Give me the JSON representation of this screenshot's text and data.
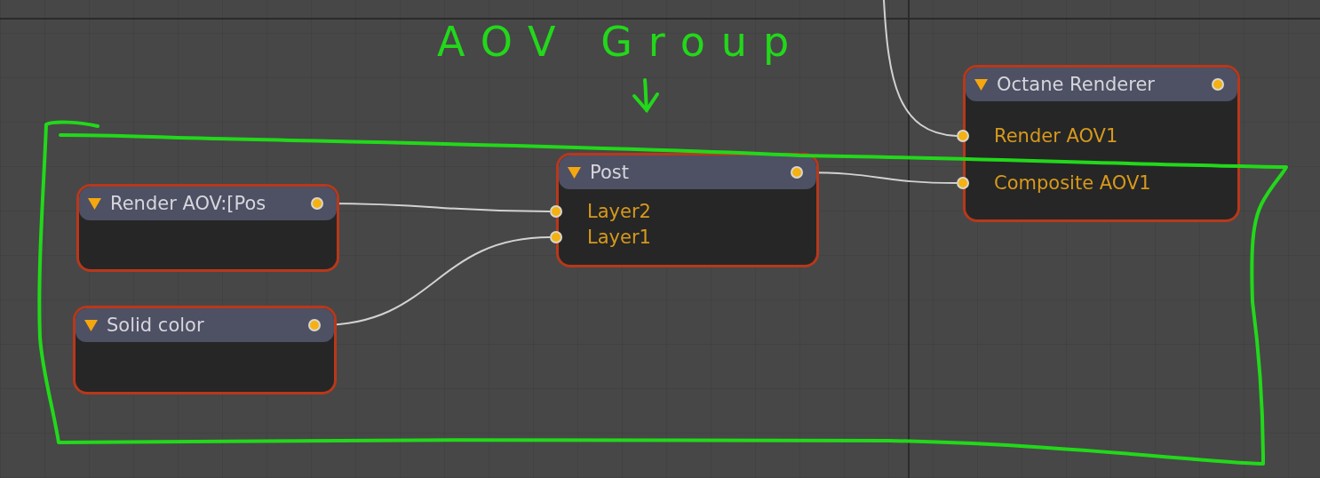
{
  "annotation": {
    "label": "AOV Group"
  },
  "nodes": [
    {
      "title": "Render AOV:[Pos"
    },
    {
      "title": "Solid color"
    },
    {
      "title": "Post",
      "inputs": [
        {
          "label": "Layer2",
          "connected": true
        },
        {
          "label": "Layer1",
          "connected": true
        }
      ]
    },
    {
      "title": "Octane Renderer",
      "inputs": [
        {
          "label": "Render AOV1",
          "connected": true
        },
        {
          "label": "Composite AOV1",
          "connected": true
        }
      ]
    }
  ]
}
